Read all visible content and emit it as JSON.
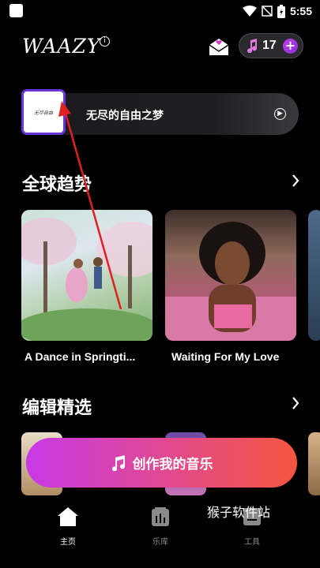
{
  "status_bar": {
    "time": "5:55"
  },
  "header": {
    "logo": "WAAZY",
    "credits": "17",
    "plus": "+"
  },
  "now_playing": {
    "title": "无尽的自由之梦",
    "thumb_text": "无尽自由"
  },
  "trending": {
    "title": "全球趋势",
    "cards": [
      {
        "title": "A Dance in Springti..."
      },
      {
        "title": "Waiting For My Love"
      }
    ]
  },
  "picks": {
    "title": "编辑精选"
  },
  "create_button": {
    "label": "创作我的音乐"
  },
  "nav": {
    "items": [
      {
        "label": "主页",
        "icon": "home-icon",
        "active": true
      },
      {
        "label": "乐库",
        "icon": "library-icon",
        "active": false
      },
      {
        "label": "工具",
        "icon": "tools-icon",
        "active": false
      }
    ]
  },
  "watermark": "猴子软件站",
  "colors": {
    "accent_purple": "#6a35d8",
    "create_start": "#c739e6",
    "create_end": "#f4563f",
    "arrow_red": "#e02020"
  }
}
